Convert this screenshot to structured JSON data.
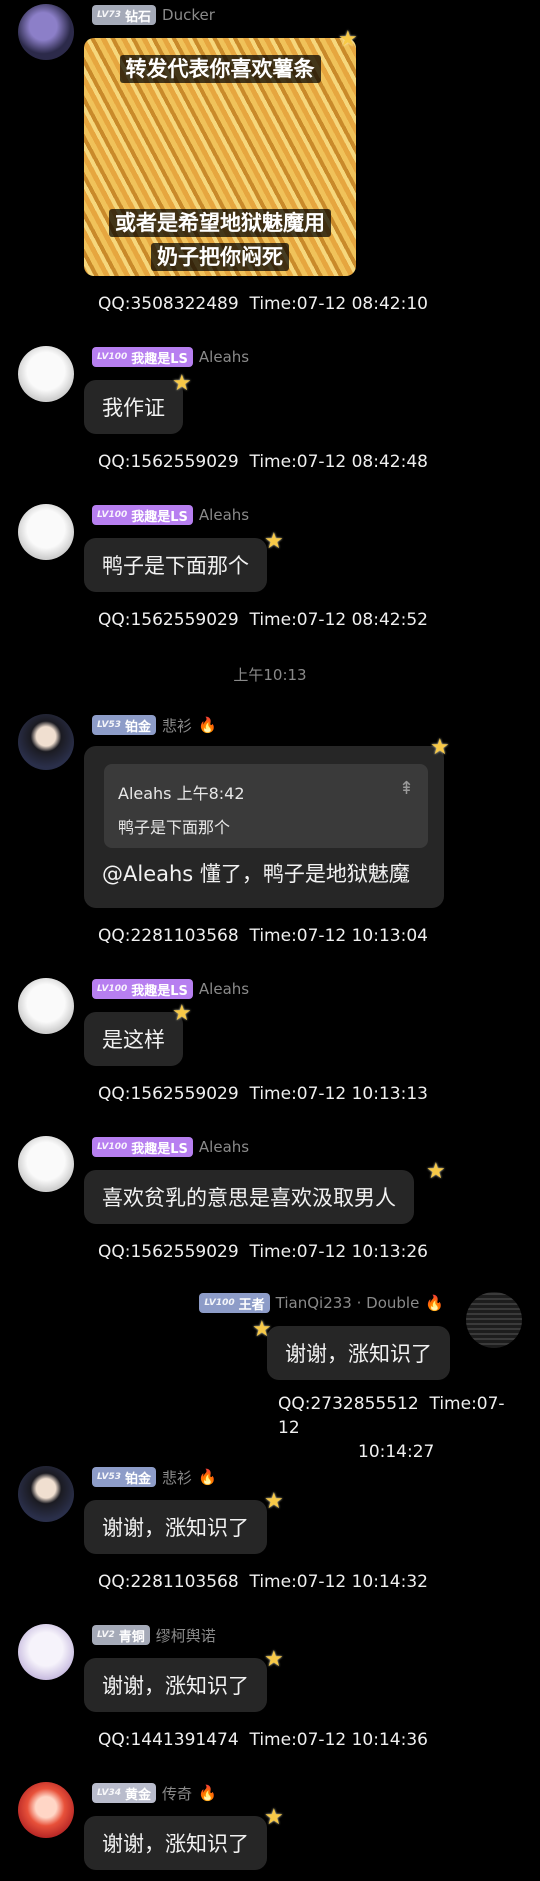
{
  "messages": [
    {
      "level": "LV73",
      "title": "钻石",
      "nick": "Ducker",
      "image_text_top": "转发代表你喜欢薯条",
      "image_text_bottom1": "或者是希望地狱魅魔用",
      "image_text_bottom2": "奶子把你闷死",
      "qq": "QQ:3508322489",
      "time": "Time:07-12 08:42:10"
    },
    {
      "level": "LV100",
      "title": "我趣是LS",
      "nick": "Aleahs",
      "text": "我作证",
      "qq": "QQ:1562559029",
      "time": "Time:07-12 08:42:48"
    },
    {
      "level": "LV100",
      "title": "我趣是LS",
      "nick": "Aleahs",
      "text": "鸭子是下面那个",
      "qq": "QQ:1562559029",
      "time": "Time:07-12 08:42:52"
    },
    {
      "level": "LV53",
      "title": "铂金",
      "nick": "悲衫",
      "fire": "🔥",
      "quote_author": "Aleahs 上午8:42",
      "quote_text": "鸭子是下面那个",
      "quote_icon": "⇞",
      "text": "@Aleahs 懂了，鸭子是地狱魅魔",
      "qq": "QQ:2281103568",
      "time": "Time:07-12 10:13:04"
    },
    {
      "level": "LV100",
      "title": "我趣是LS",
      "nick": "Aleahs",
      "text": "是这样",
      "qq": "QQ:1562559029",
      "time": "Time:07-12 10:13:13"
    },
    {
      "level": "LV100",
      "title": "我趣是LS",
      "nick": "Aleahs",
      "text": "喜欢贫乳的意思是喜欢汲取男人",
      "qq": "QQ:1562559029",
      "time": "Time:07-12 10:13:26"
    },
    {
      "level": "LV100",
      "title": "王者",
      "nick": "TianQi233 · Double",
      "fire": "🔥",
      "text": "谢谢，涨知识了",
      "qq": "QQ:2732855512",
      "time1": "Time:07-12",
      "time2": "10:14:27"
    },
    {
      "level": "LV53",
      "title": "铂金",
      "nick": "悲衫",
      "fire": "🔥",
      "text": "谢谢，涨知识了",
      "qq": "QQ:2281103568",
      "time": "Time:07-12 10:14:32"
    },
    {
      "level": "LV2",
      "title": "青铜",
      "nick": "缪柯舆诺",
      "text": "谢谢，涨知识了",
      "qq": "QQ:1441391474",
      "time": "Time:07-12 10:14:36"
    },
    {
      "level": "LV34",
      "title": "黄金",
      "nick": "传奇",
      "fire": "🔥",
      "text": "谢谢，涨知识了"
    }
  ],
  "time_separator": "上午10:13",
  "star_icon": "★",
  "icons": {
    "star": "star-icon",
    "fire": "fire-icon",
    "quote": "pin-top-icon"
  }
}
